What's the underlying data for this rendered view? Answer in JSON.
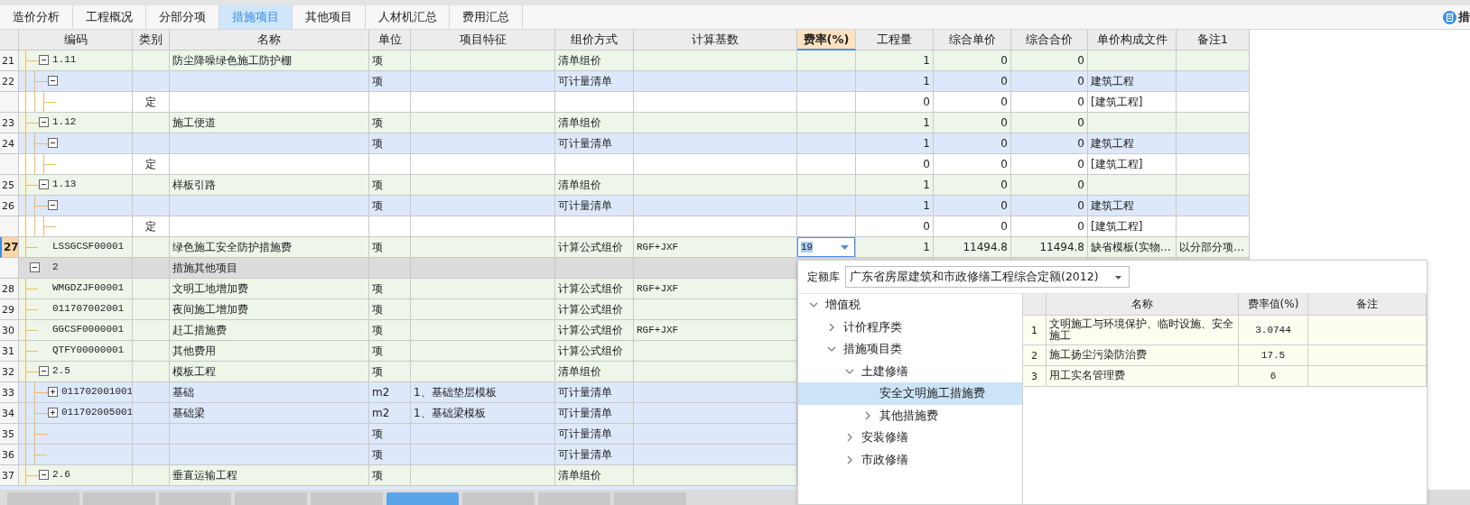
{
  "tabs": [
    {
      "label": "造价分析",
      "selected": false
    },
    {
      "label": "工程概况",
      "selected": false
    },
    {
      "label": "分部分项",
      "selected": false
    },
    {
      "label": "措施项目",
      "selected": true
    },
    {
      "label": "其他项目",
      "selected": false
    },
    {
      "label": "人材机汇总",
      "selected": false
    },
    {
      "label": "费用汇总",
      "selected": false
    }
  ],
  "side_button": {
    "label": "措"
  },
  "columns": [
    {
      "label": "编码",
      "selected": false
    },
    {
      "label": "类别",
      "selected": false
    },
    {
      "label": "名称",
      "selected": false
    },
    {
      "label": "单位",
      "selected": false
    },
    {
      "label": "项目特征",
      "selected": false
    },
    {
      "label": "组价方式",
      "selected": false
    },
    {
      "label": "计算基数",
      "selected": false
    },
    {
      "label": "费率(%)",
      "selected": true
    },
    {
      "label": "工程量",
      "selected": false
    },
    {
      "label": "综合单价",
      "selected": false
    },
    {
      "label": "综合合价",
      "selected": false
    },
    {
      "label": "单价构成文件",
      "selected": false
    },
    {
      "label": "备注1",
      "selected": false
    }
  ],
  "rows": [
    {
      "kind": "measure",
      "no": "21",
      "code": "1.11",
      "name": "防尘降噪绿色施工防护棚",
      "unit": "项",
      "method": "清单组价",
      "qty": "1",
      "unit_price": "0",
      "total": "0",
      "expanded": true,
      "selected": false,
      "children": [
        {
          "kind": "list",
          "no": "22",
          "unit": "项",
          "method": "可计量清单",
          "qty": "1",
          "unit_price": "0",
          "total": "0",
          "template": "建筑工程",
          "expanded": true,
          "selected": false,
          "children": [
            {
              "kind": "quota",
              "type": "定",
              "qty": "0",
              "unit_price": "0",
              "total": "0",
              "template": "[建筑工程]",
              "selected": false
            }
          ]
        }
      ]
    },
    {
      "kind": "measure",
      "no": "23",
      "code": "1.12",
      "name": "施工便道",
      "unit": "项",
      "method": "清单组价",
      "qty": "1",
      "unit_price": "0",
      "total": "0",
      "expanded": true,
      "selected": false,
      "children": [
        {
          "kind": "list",
          "no": "24",
          "unit": "项",
          "method": "可计量清单",
          "qty": "1",
          "unit_price": "0",
          "total": "0",
          "template": "建筑工程",
          "expanded": true,
          "selected": false,
          "children": [
            {
              "kind": "quota",
              "type": "定",
              "qty": "0",
              "unit_price": "0",
              "total": "0",
              "template": "[建筑工程]",
              "selected": false
            }
          ]
        }
      ]
    },
    {
      "kind": "measure",
      "no": "25",
      "code": "1.13",
      "name": "样板引路",
      "unit": "项",
      "method": "清单组价",
      "qty": "1",
      "unit_price": "0",
      "total": "0",
      "expanded": true,
      "selected": false,
      "children": [
        {
          "kind": "list",
          "no": "26",
          "unit": "项",
          "method": "可计量清单",
          "qty": "1",
          "unit_price": "0",
          "total": "0",
          "template": "建筑工程",
          "expanded": true,
          "selected": false,
          "children": [
            {
              "kind": "quota",
              "type": "定",
              "qty": "0",
              "unit_price": "0",
              "total": "0",
              "template": "[建筑工程]",
              "selected": false
            }
          ]
        }
      ]
    },
    {
      "kind": "measure",
      "no": "27",
      "code": "LSSGCSF00001",
      "name": "绿色施工安全防护措施费",
      "unit": "项",
      "method": "计算公式组价",
      "base": "RGF+JXF",
      "rate": "19",
      "qty": "1",
      "unit_price": "11494.8",
      "total": "11494.8",
      "template": "缺省模板(实物…",
      "note": "以分部分项…",
      "selected": true
    },
    {
      "kind": "section",
      "code": "2",
      "name": "措施其他项目",
      "expanded": true,
      "selected": false,
      "children": [
        {
          "kind": "measure",
          "no": "28",
          "code": "WMGDZJF00001",
          "name": "文明工地增加费",
          "unit": "项",
          "method": "计算公式组价",
          "base": "RGF+JXF",
          "selected": false
        },
        {
          "kind": "measure",
          "no": "29",
          "code": "011707002001",
          "name": "夜间施工增加费",
          "unit": "项",
          "method": "计算公式组价",
          "selected": false
        },
        {
          "kind": "measure",
          "no": "30",
          "code": "GGCSF0000001",
          "name": "赶工措施费",
          "unit": "项",
          "method": "计算公式组价",
          "base": "RGF+JXF",
          "selected": false
        },
        {
          "kind": "measure",
          "no": "31",
          "code": "QTFY00000001",
          "name": "其他费用",
          "unit": "项",
          "method": "计算公式组价",
          "selected": false
        },
        {
          "kind": "measure",
          "no": "32",
          "code": "2.5",
          "name": "模板工程",
          "unit": "项",
          "method": "清单组价",
          "expanded": true,
          "selected": false,
          "children": [
            {
              "kind": "list",
              "no": "33",
              "code": "011702001001",
              "name": "基础",
              "unit": "m2",
              "feature": "1、基础垫层模板",
              "method": "可计量清单",
              "expanded": false,
              "selected": false
            },
            {
              "kind": "list",
              "no": "34",
              "code": "011702005001",
              "name": "基础梁",
              "unit": "m2",
              "feature": "1、基础梁模板",
              "method": "可计量清单",
              "expanded": false,
              "selected": false
            },
            {
              "kind": "list",
              "no": "35",
              "unit": "项",
              "method": "可计量清单",
              "selected": false
            },
            {
              "kind": "list",
              "no": "36",
              "unit": "项",
              "method": "可计量清单",
              "selected": false
            }
          ]
        },
        {
          "kind": "measure",
          "no": "37",
          "code": "2.6",
          "name": "垂直运输工程",
          "unit": "项",
          "method": "清单组价",
          "expanded": true,
          "selected": false
        }
      ]
    }
  ],
  "bottom_tabs": [
    {
      "selected": false
    },
    {
      "selected": false
    },
    {
      "selected": false
    },
    {
      "selected": false
    },
    {
      "selected": false
    },
    {
      "selected": true
    },
    {
      "selected": false
    },
    {
      "selected": false
    },
    {
      "selected": false
    }
  ],
  "quota_panel": {
    "library_label": "定额库",
    "library": "广东省房屋建筑和市政修缮工程综合定额(2012)",
    "tree": [
      {
        "label": "增值税",
        "expanded": true,
        "selected": false,
        "children": [
          {
            "label": "计价程序类",
            "expanded": false,
            "selected": false
          },
          {
            "label": "措施项目类",
            "expanded": true,
            "selected": false,
            "children": [
              {
                "label": "土建修缮",
                "expanded": true,
                "selected": false,
                "children": [
                  {
                    "label": "安全文明施工措施费",
                    "selected": true
                  },
                  {
                    "label": "其他措施费",
                    "expanded": false,
                    "selected": false
                  }
                ]
              },
              {
                "label": "安装修缮",
                "expanded": false,
                "selected": false
              },
              {
                "label": "市政修缮",
                "expanded": false,
                "selected": false
              }
            ]
          }
        ]
      }
    ],
    "columns": [
      "名称",
      "费率值(%)",
      "备注"
    ],
    "rates": [
      {
        "no": "1",
        "name": "文明施工与环境保护、临时设施、安全施工",
        "value": "3.0744"
      },
      {
        "no": "2",
        "name": "施工扬尘污染防治费",
        "value": "17.5"
      },
      {
        "no": "3",
        "name": "用工实名管理费",
        "value": "6"
      }
    ]
  }
}
